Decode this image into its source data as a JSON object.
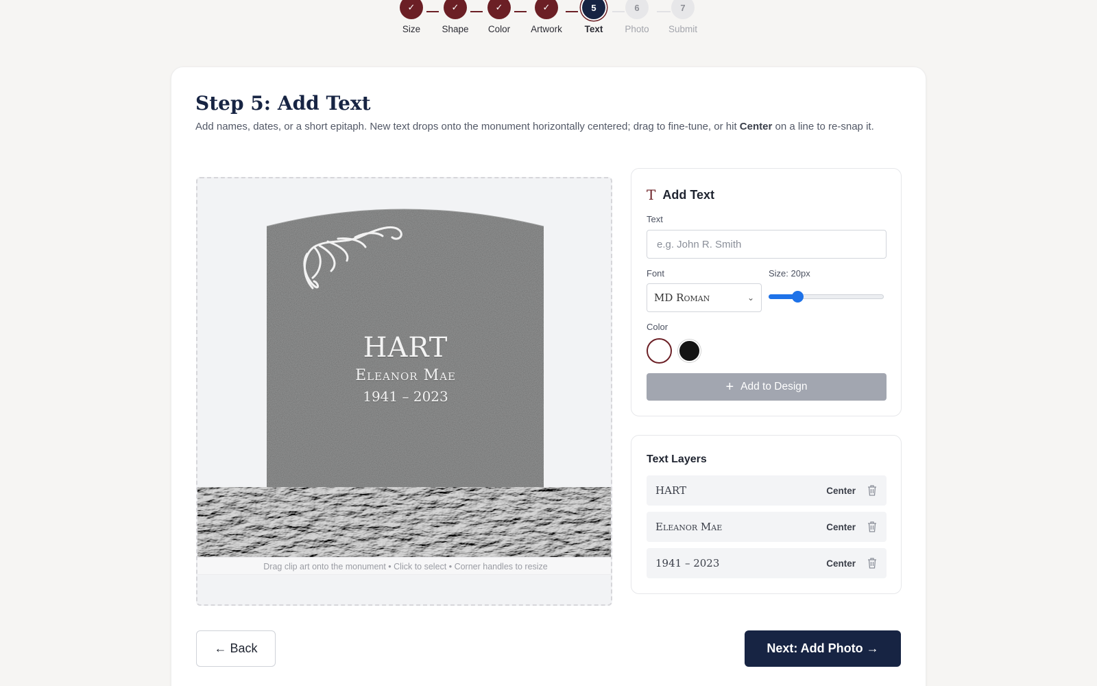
{
  "stepper": {
    "steps": [
      {
        "num": "✓",
        "label": "Size",
        "state": "done"
      },
      {
        "num": "✓",
        "label": "Shape",
        "state": "done"
      },
      {
        "num": "✓",
        "label": "Color",
        "state": "done"
      },
      {
        "num": "✓",
        "label": "Artwork",
        "state": "done"
      },
      {
        "num": "5",
        "label": "Text",
        "state": "active"
      },
      {
        "num": "6",
        "label": "Photo",
        "state": "todo"
      },
      {
        "num": "7",
        "label": "Submit",
        "state": "todo"
      }
    ]
  },
  "page": {
    "title": "Step 5: Add Text",
    "desc_before": "Add names, dates, or a short epitaph. New text drops onto the monument horizontally centered; drag to fine-tune, or hit ",
    "desc_bold": "Center",
    "desc_after": " on a line to re-snap it."
  },
  "canvas": {
    "inscription_line1": "HART",
    "inscription_line2": "Eleanor Mae",
    "inscription_line3": "1941 – 2023",
    "hint": "Drag clip art onto the monument • Click to select • Corner handles to resize",
    "text_color": "#f4f4f4"
  },
  "add_text": {
    "heading": "Add Text",
    "heading_icon": "T",
    "text_label": "Text",
    "text_placeholder": "e.g. John R. Smith",
    "text_value": "",
    "font_label": "Font",
    "font_value": "MD Roman",
    "size_label": "Size: 20px",
    "size_fraction": 0.25,
    "color_label": "Color",
    "colors": [
      "#ffffff",
      "#141414"
    ],
    "selected_color": "#ffffff",
    "add_button": "Add to Design"
  },
  "layers": {
    "heading": "Text Layers",
    "items": [
      {
        "name": "HART",
        "center_label": "Center"
      },
      {
        "name": "Eleanor Mae",
        "center_label": "Center"
      },
      {
        "name": "1941 – 2023",
        "center_label": "Center"
      }
    ]
  },
  "footer": {
    "back_label": "← Back",
    "next_label": "Next: Add Photo →"
  },
  "colors": {
    "brand_maroon": "#6b1f25",
    "navy": "#172443",
    "slider_blue": "#1e72e8",
    "disabled_button": "#a2a6b0"
  }
}
